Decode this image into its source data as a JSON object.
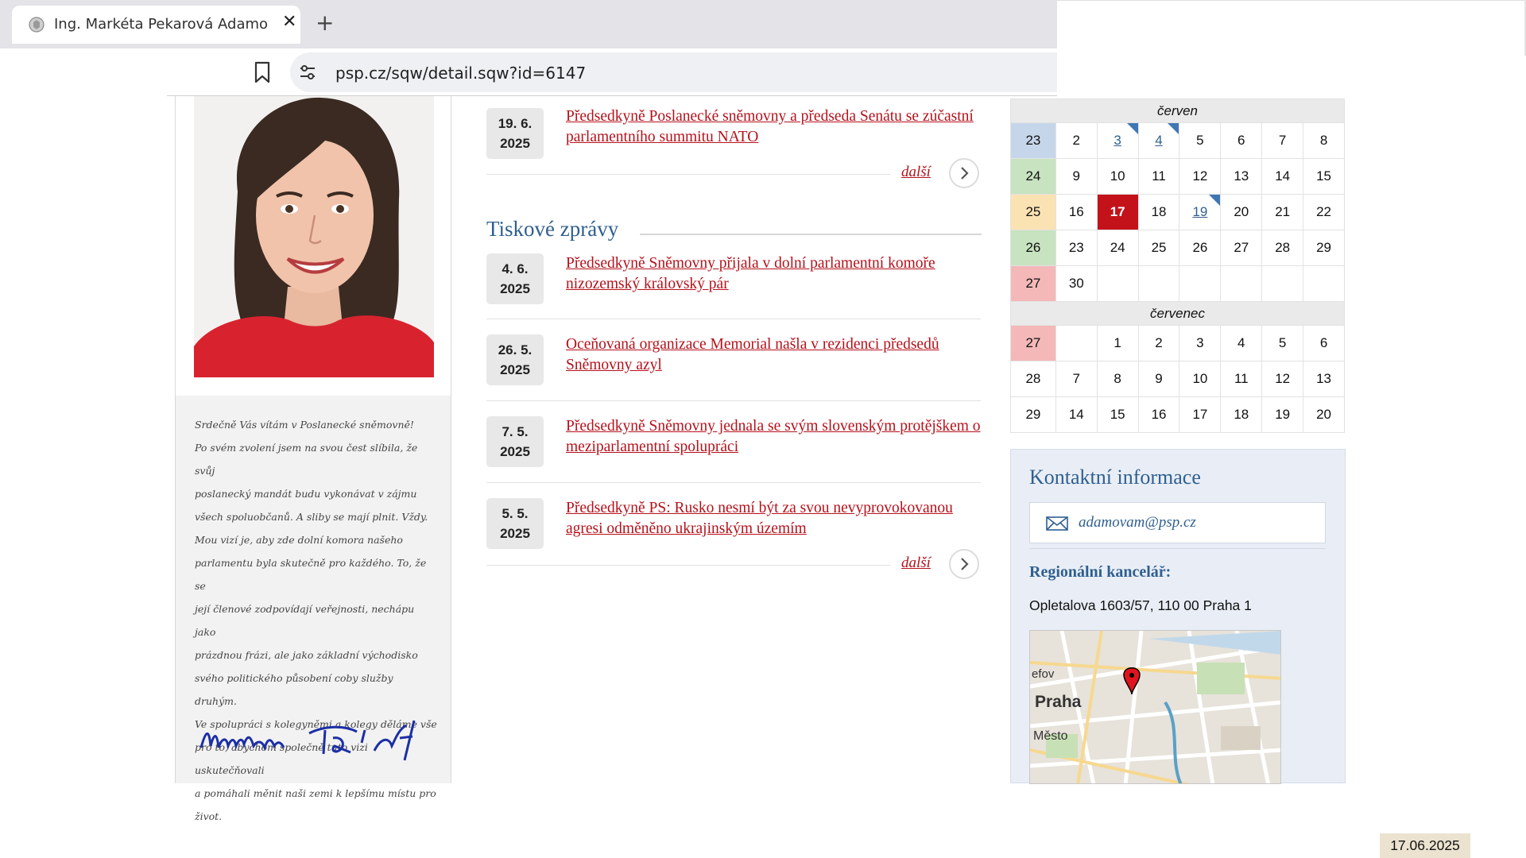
{
  "browser": {
    "tab_title": "Ing. Markéta Pekarová Adamová",
    "tab_close": "✕",
    "new_tab": "+",
    "url": "psp.cz/sqw/detail.sqw?id=6147"
  },
  "welcome": {
    "lines": [
      "Srdečně Vás vítám v Poslanecké sněmovně!",
      "Po svém zvolení jsem na svou čest slíbila, že svůj",
      "poslanecký mandát budu vykonávat v zájmu",
      "všech spoluobčanů. A sliby se mají plnit. Vždy.",
      "Mou vizí je, aby zde dolní komora našeho",
      "parlamentu byla skutečně pro každého. To, že se",
      "její členové zodpovídají veřejnosti, nechápu jako",
      "prázdnou frázi, ale jako základní východisko",
      "svého politického působení coby služby druhým.",
      "Ve spolupráci s kolegyněmi a kolegy děláme vše",
      "pro to, abychom společně tuto vizi uskutečňovali",
      "a pomáhali měnit naši zemi k lepšímu místu pro",
      "život."
    ]
  },
  "news_top": {
    "date_day": "19. 6.",
    "date_year": "2025",
    "title": "Předsedkyně Poslanecké sněmovny a předseda Senátu se zúčastní parlamentního summitu NATO",
    "more": "další"
  },
  "press": {
    "section_title": "Tiskové zprávy",
    "items": [
      {
        "day": "4. 6.",
        "year": "2025",
        "title": "Předsedkyně Sněmovny přijala v dolní parlamentní komoře nizozemský královský pár"
      },
      {
        "day": "26. 5.",
        "year": "2025",
        "title": "Oceňovaná organizace Memorial našla v rezidenci předsedů Sněmovny azyl"
      },
      {
        "day": "7. 5.",
        "year": "2025",
        "title": "Předsedkyně Sněmovny jednala se svým slovenským protějškem o meziparlamentní spolupráci"
      },
      {
        "day": "5. 5.",
        "year": "2025",
        "title": "Předsedkyně PS: Rusko nesmí být za svou nevyprovokovanou agresi odměněno ukrajinským územím"
      }
    ],
    "more": "další"
  },
  "calendar": {
    "june": {
      "name": "červen",
      "weeks": [
        [
          "23",
          "2",
          "3",
          "4",
          "5",
          "6",
          "7",
          "8"
        ],
        [
          "24",
          "9",
          "10",
          "11",
          "12",
          "13",
          "14",
          "15"
        ],
        [
          "25",
          "16",
          "17",
          "18",
          "19",
          "20",
          "21",
          "22"
        ],
        [
          "26",
          "23",
          "24",
          "25",
          "26",
          "27",
          "28",
          "29"
        ],
        [
          "27",
          "30",
          "",
          "",
          "",
          "",
          "",
          ""
        ]
      ]
    },
    "july": {
      "name": "červenec",
      "weeks": [
        [
          "27",
          "",
          "1",
          "2",
          "3",
          "4",
          "5",
          "6"
        ],
        [
          "28",
          "7",
          "8",
          "9",
          "10",
          "11",
          "12",
          "13"
        ],
        [
          "29",
          "14",
          "15",
          "16",
          "17",
          "18",
          "19",
          "20"
        ]
      ]
    },
    "today": "17",
    "event_days": [
      "3",
      "4",
      "19"
    ],
    "colors": {
      "week_blue": "#c6d6ea",
      "week_green": "#c7e3c0",
      "week_yellow": "#fbe2b3",
      "week_red": "#f4b8b8",
      "today": "#c4121b"
    }
  },
  "contact": {
    "title": "Kontaktní informace",
    "email": "adamovam@psp.cz",
    "region_title": "Regionální kancelář:",
    "address": "Opletalova 1603/57, 110 00  Praha 1",
    "map_labels": [
      "efov",
      "Praha",
      "Město"
    ]
  },
  "date_stamp": "17.06.2025",
  "colors": {
    "accent_red": "#b5111b",
    "accent_blue": "#2f5f8f"
  }
}
